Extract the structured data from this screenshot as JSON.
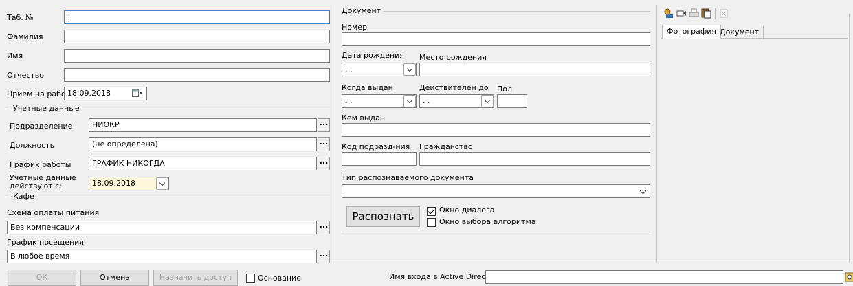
{
  "left": {
    "tab_no": {
      "label": "Таб. №",
      "value": ""
    },
    "lastname": {
      "label": "Фамилия",
      "value": ""
    },
    "firstname": {
      "label": "Имя",
      "value": ""
    },
    "patronymic": {
      "label": "Отчество",
      "value": ""
    },
    "hire_date": {
      "label": "Прием на работу",
      "value": "18.09.2018"
    },
    "accounting": {
      "title": "Учетные данные",
      "department": {
        "label": "Подразделение",
        "value": "НИОКР"
      },
      "position": {
        "label": "Должность",
        "value": "(не определена)"
      },
      "schedule": {
        "label": "График работы",
        "value": "ГРАФИК НИКОГДА"
      },
      "effective": {
        "label_line1": "Учетные данные",
        "label_line2": "действуют с:",
        "value": "18.09.2018"
      }
    },
    "cafe": {
      "title": "Кафе",
      "payment_scheme": {
        "label": "Схема оплаты питания",
        "value": "Без компенсации"
      },
      "visit_schedule": {
        "label": "График посещения",
        "value": "В любое время"
      }
    },
    "ellipsis": "..."
  },
  "document": {
    "title": "Документ",
    "number": {
      "label": "Номер",
      "value": ""
    },
    "birth_date": {
      "label": "Дата рождения",
      "value": ". ."
    },
    "birth_place": {
      "label": "Место рождения",
      "value": ""
    },
    "issue_date": {
      "label": "Когда выдан",
      "value": ". ."
    },
    "valid_until": {
      "label": "Действителен до",
      "value": ". ."
    },
    "sex": {
      "label": "Пол",
      "value": ""
    },
    "issued_by": {
      "label": "Кем выдан",
      "value": ""
    },
    "dept_code": {
      "label": "Код подразд-ния",
      "value": ""
    },
    "citizenship": {
      "label": "Гражданство",
      "value": ""
    },
    "recognized_type": {
      "label": "Тип распознаваемого документа",
      "value": ""
    },
    "recognize_button": "Распознать",
    "dialog_window": {
      "label": "Окно диалога",
      "checked": true
    },
    "algorithm_window": {
      "label": "Окно выбора алгоритма",
      "checked": false
    }
  },
  "right_panel": {
    "toolbar_icons": [
      "camera-icon",
      "video-icon",
      "print-icon",
      "paste-icon",
      "clear-icon"
    ],
    "tabs": [
      {
        "label": "Фотография",
        "active": true
      },
      {
        "label": "Документ",
        "active": false
      }
    ]
  },
  "bottom": {
    "ok": "ОК",
    "cancel": "Отмена",
    "assign_access": "Назначить доступ",
    "basis": {
      "label": "Основание",
      "checked": false
    },
    "ad_login": {
      "label": "Имя входа в Active Directory",
      "value": ""
    }
  }
}
